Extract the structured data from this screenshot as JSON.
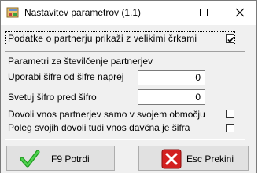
{
  "window": {
    "title": "Nastavitev parametrov  (1.1)"
  },
  "options": {
    "partner_name_uppercase": {
      "label": "Podatke o partnerju prikaži z velikimi črkami",
      "checked": true
    }
  },
  "numbering": {
    "section_title": "Parametri za številčenje partnerjev",
    "use_code_from": {
      "label": "Uporabi šifre od šifre naprej",
      "value": "0"
    },
    "suggest_before": {
      "label": "Svetuj šifro pred šifro",
      "value": "0"
    },
    "allow_only_own_area": {
      "label": "Dovoli vnos partnerjev samo v svojem območju",
      "checked": false
    },
    "allow_tax_code": {
      "label": "Poleg svojih dovoli tudi vnos davčna je šifra",
      "checked": false
    }
  },
  "buttons": {
    "confirm_label": "F9 Potrdi",
    "cancel_label": "Esc Prekini"
  },
  "colors": {
    "check_green": "#2db82d",
    "cancel_red": "#d32020",
    "window_bg": "#f0f0f0"
  }
}
